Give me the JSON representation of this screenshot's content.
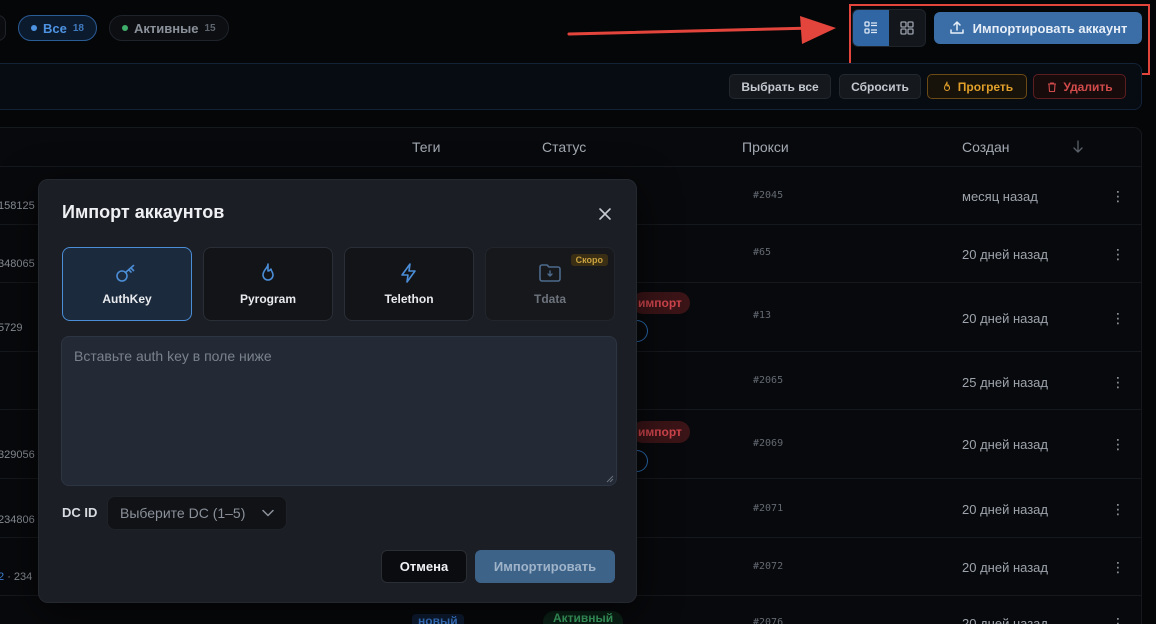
{
  "filters": {
    "all": {
      "label": "Все",
      "count": "18"
    },
    "active": {
      "label": "Активные",
      "count": "15"
    }
  },
  "toolbar": {
    "import_account_label": "Импортировать аккаунт"
  },
  "actions": {
    "select_all": "Выбрать все",
    "reset": "Сбросить",
    "warm": "Прогреть",
    "delete": "Удалить"
  },
  "table": {
    "headers": {
      "tags": "Теги",
      "status": "Статус",
      "proxy": "Прокси",
      "created": "Создан"
    },
    "rows": [
      {
        "id": "158125",
        "proxy": "#2045",
        "created": "месяц назад"
      },
      {
        "id": "348065",
        "proxy": "#65",
        "created": "20 дней назад"
      },
      {
        "id": "5729",
        "proxy": "#13",
        "created": "20 дней назад",
        "status": "импорт"
      },
      {
        "id": "",
        "proxy": "#2065",
        "created": "25 дней назад"
      },
      {
        "id": "329056",
        "proxy": "#2069",
        "created": "20 дней назад",
        "status": "импорт"
      },
      {
        "id": "234806",
        "proxy": "#2071",
        "created": "20 дней назад"
      },
      {
        "id_blue": "2",
        "id_sep": "·",
        "id": "234",
        "proxy": "#2072",
        "created": "20 дней назад"
      },
      {
        "id": "",
        "proxy": "#2076",
        "created": "20 дней назад",
        "tag": "новый",
        "status": "Активный"
      }
    ]
  },
  "modal": {
    "title": "Импорт аккаунтов",
    "types": [
      {
        "label": "AuthKey",
        "icon": "key-icon",
        "selected": true
      },
      {
        "label": "Pyrogram",
        "icon": "flame-icon"
      },
      {
        "label": "Telethon",
        "icon": "bolt-icon"
      },
      {
        "label": "Tdata",
        "icon": "folder-icon",
        "badge": "Скоро",
        "disabled": true
      }
    ],
    "auth_placeholder": "Вставьте auth key в поле ниже",
    "dc_label": "DC ID",
    "dc_placeholder": "Выберите DC (1–5)",
    "cancel_label": "Отмена",
    "import_label": "Импортировать"
  },
  "colors": {
    "accent": "#3b6da6",
    "highlight": "#e3443b",
    "danger": "#d24b4b",
    "warning": "#e0a02a",
    "success": "#3fae6a"
  }
}
